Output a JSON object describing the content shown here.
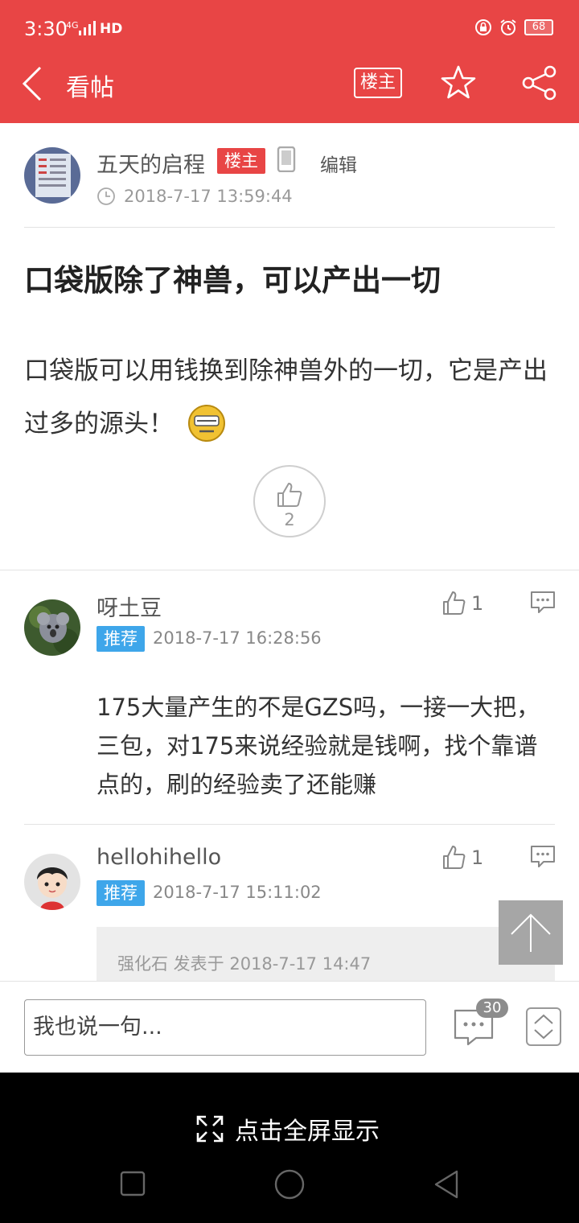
{
  "status": {
    "time": "3:30",
    "network": "4G",
    "hd": "HD",
    "battery": "68"
  },
  "appbar": {
    "title": "看帖",
    "owner_button": "楼主"
  },
  "post": {
    "author": "五天的启程",
    "author_badge": "楼主",
    "edit_label": "编辑",
    "time": "2018-7-17 13:59:44",
    "title": "口袋版除了神兽，可以产出一切",
    "body": "口袋版可以用钱换到除神兽外的一切，它是产出过多的源头！",
    "likes": "2"
  },
  "replies": [
    {
      "name": "呀土豆",
      "badge": "推荐",
      "time": "2018-7-17 16:28:56",
      "likes": "1",
      "text": "175大量产生的不是GZS吗，一接一大把，三包，对175来说经验就是钱啊，找个靠谱点的，刷的经验卖了还能赚"
    },
    {
      "name": "hellohihello",
      "badge": "推荐",
      "time": "2018-7-17 15:11:02",
      "likes": "1",
      "quote": "强化石 发表于 2018-7-17 14:47"
    }
  ],
  "input": {
    "placeholder": "我也说一句...",
    "comment_count": "30"
  },
  "fullscreen_label": "点击全屏显示",
  "colors": {
    "brand_red": "#e84545",
    "recommend_blue": "#3ea6ea"
  }
}
